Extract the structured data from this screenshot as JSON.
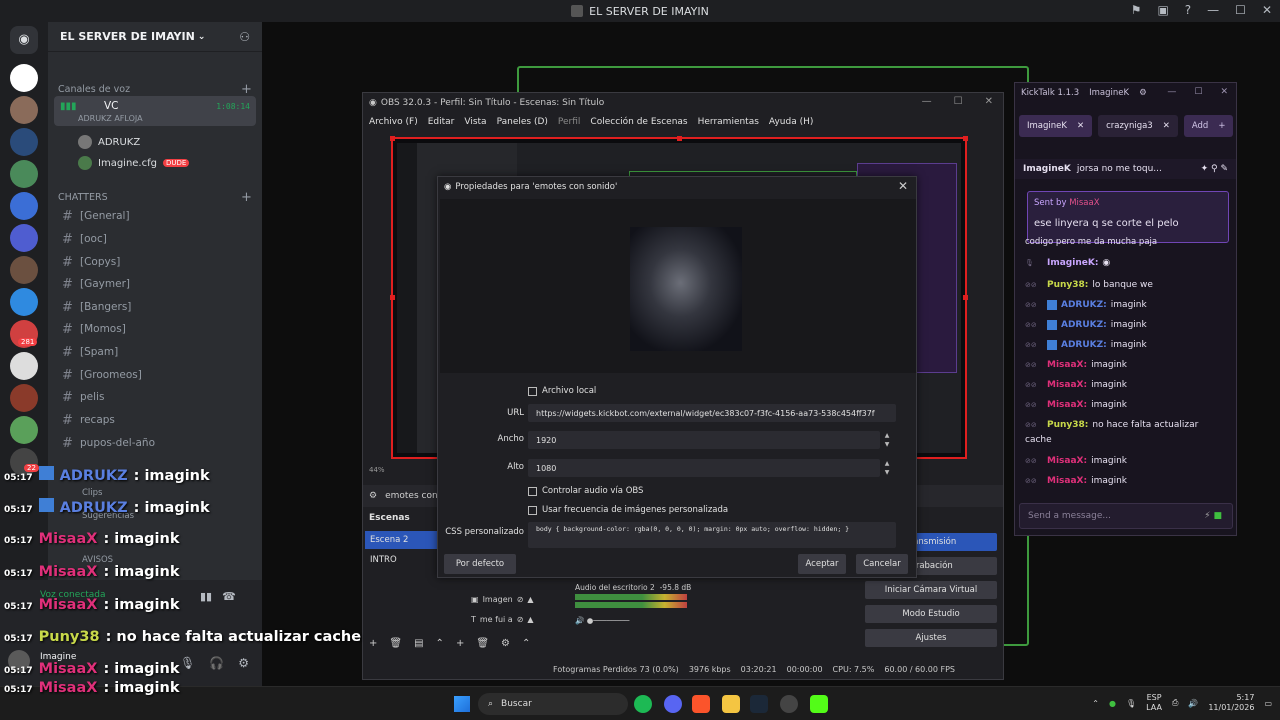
{
  "window_title": "EL SERVER DE IMAYIN",
  "discord": {
    "server_name": "EL SERVER DE IMAYIN",
    "categories": {
      "voice": "Canales de voz",
      "chatters": "CHATTERS"
    },
    "voice_channel": {
      "name": "VC",
      "status": "ADRUKZ AFLOJA",
      "timer": "1:08:14"
    },
    "voice_users": [
      {
        "name": "ADRUKZ"
      },
      {
        "name": "Imagine.cfg",
        "badge": "DUDE"
      }
    ],
    "text_channels": [
      "[General]",
      "[ooc]",
      "[Copys]",
      "[Gaymer]",
      "[Bangers]",
      "[Momos]",
      "[Spam]",
      "[Groomeos]",
      "pelis",
      "recaps",
      "pupos-del-año"
    ],
    "lower_items": [
      "Clips",
      "Sugerencias",
      "AVISOS"
    ],
    "voice_connected": "Voz conectada",
    "user_name": "Imagine",
    "server_badges": [
      "281",
      "22"
    ]
  },
  "overlay_chat": [
    {
      "time": "05:17",
      "user": "ADRUKZ",
      "color": "#5a7fe0",
      "kick": true,
      "text": ": imagink"
    },
    {
      "time": "05:17",
      "user": "ADRUKZ",
      "color": "#5a7fe0",
      "kick": true,
      "text": ": imagink"
    },
    {
      "time": "05:17",
      "user": "MisaaX",
      "color": "#e0307a",
      "kick": false,
      "text": ": imagink"
    },
    {
      "time": "05:17",
      "user": "MisaaX",
      "color": "#e0307a",
      "kick": false,
      "text": ": imagink"
    },
    {
      "time": "05:17",
      "user": "MisaaX",
      "color": "#e0307a",
      "kick": false,
      "text": ": imagink"
    },
    {
      "time": "05:17",
      "user": "Puny38",
      "color": "#c8d94a",
      "kick": false,
      "text": ": no hace falta actualizar cache"
    },
    {
      "time": "05:17",
      "user": "MisaaX",
      "color": "#e0307a",
      "kick": false,
      "text": ": imagink"
    },
    {
      "time": "05:17",
      "user": "MisaaX",
      "color": "#e0307a",
      "kick": false,
      "text": ": imagink"
    }
  ],
  "obs": {
    "title": "OBS 32.0.3 - Perfil: Sin Título - Escenas: Sin Título",
    "menu": [
      "Archivo (F)",
      "Editar",
      "Vista",
      "Paneles (D)",
      "Perfil",
      "Colección de Escenas",
      "Herramientas",
      "Ayuda (H)"
    ],
    "source_selected": "emotes con",
    "scenes_header": "Escenas",
    "scenes": [
      "Escena 2",
      "INTRO"
    ],
    "sources": [
      "Imagen",
      "me fui a"
    ],
    "mixer": {
      "name": "Audio del escritorio 2",
      "db": "-95.8 dB"
    },
    "controls": [
      "Transmisión",
      "Grabación",
      "Iniciar Cámara Virtual",
      "Modo Estudio",
      "Ajustes"
    ],
    "status": {
      "frames": "Fotogramas Perdidos 73 (0.0%)",
      "kbps": "3976 kbps",
      "rec_time": "03:20:21",
      "stream_time": "00:00:00",
      "cpu": "CPU: 7.5%",
      "fps": "60.00 / 60.00 FPS"
    },
    "zoom": "44%"
  },
  "dialog": {
    "title": "Propiedades para 'emotes con sonido'",
    "local_file_label": "Archivo local",
    "url_label": "URL",
    "url_value": "https://widgets.kickbot.com/external/widget/ec383c07-f3fc-4156-aa73-538c454ff37f",
    "width_label": "Ancho",
    "width_value": "1920",
    "height_label": "Alto",
    "height_value": "1080",
    "audio_label": "Controlar audio vía OBS",
    "fps_label": "Usar frecuencia de imágenes personalizada",
    "css_label": "CSS personalizado",
    "css_value": "body { background-color: rgba(0, 0, 0, 0); margin: 0px auto; overflow: hidden; }",
    "defaults_button": "Por defecto",
    "ok_button": "Aceptar",
    "cancel_button": "Cancelar"
  },
  "kicktalk": {
    "title": "KickTalk 1.1.3",
    "user": "ImagineK",
    "tabs": [
      "ImagineK",
      "crazyniga3"
    ],
    "add_label": "Add",
    "pinned": {
      "user": "ImagineK",
      "text": "jorsa no me toqu..."
    },
    "reply": {
      "sent_by": "Sent by",
      "sent_user": "MisaaX",
      "text": "ese linyera q se corte el pelo"
    },
    "partial_line": "codigo pero me da mucha paja",
    "messages": [
      {
        "user": "ImagineK:",
        "color": "#c9a6ff",
        "text": ""
      },
      {
        "user": "Puny38:",
        "color": "#c8d94a",
        "text": "lo banque we"
      },
      {
        "user": "ADRUKZ:",
        "color": "#5a7fe0",
        "text": "imagink"
      },
      {
        "user": "ADRUKZ:",
        "color": "#5a7fe0",
        "text": "imagink"
      },
      {
        "user": "ADRUKZ:",
        "color": "#5a7fe0",
        "text": "imagink"
      },
      {
        "user": "MisaaX:",
        "color": "#e0307a",
        "text": "imagink"
      },
      {
        "user": "MisaaX:",
        "color": "#e0307a",
        "text": "imagink"
      },
      {
        "user": "MisaaX:",
        "color": "#e0307a",
        "text": "imagink"
      },
      {
        "user": "Puny38:",
        "color": "#c8d94a",
        "text": "no hace falta actualizar"
      },
      {
        "user": "MisaaX:",
        "color": "#e0307a",
        "text": "imagink"
      },
      {
        "user": "MisaaX:",
        "color": "#e0307a",
        "text": "imagink"
      }
    ],
    "wrap_text": "cache",
    "input_placeholder": "Send a message..."
  },
  "taskbar": {
    "search_placeholder": "Buscar",
    "lang": "ESP",
    "region": "LAA",
    "time": "5:17",
    "date": "11/01/2026"
  }
}
